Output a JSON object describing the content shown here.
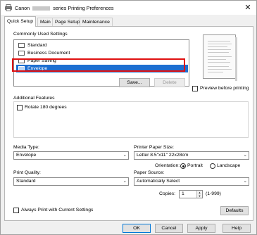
{
  "title": {
    "prefix": "Canon",
    "suffix": "series Printing Preferences",
    "close_glyph": "✕"
  },
  "tabs": [
    {
      "label": "Quick Setup",
      "active": true
    },
    {
      "label": "Main"
    },
    {
      "label": "Page Setup"
    },
    {
      "label": "Maintenance"
    }
  ],
  "commonly_used": {
    "label": "Commonly Used Settings",
    "items": [
      "Standard",
      "Business Document",
      "Paper Saving",
      "Envelope"
    ],
    "selected_index": 3,
    "save_label": "Save...",
    "delete_label": "Delete"
  },
  "preview": {
    "checkbox_label": "Preview before printing",
    "checked": false
  },
  "additional_features": {
    "label": "Additional Features",
    "rotate_label": "Rotate 180 degrees",
    "rotate_checked": false
  },
  "media_type": {
    "label": "Media Type:",
    "value": "Envelope"
  },
  "printer_paper_size": {
    "label": "Printer Paper Size:",
    "value": "Letter 8.5\"x11\" 22x28cm"
  },
  "orientation": {
    "label": "Orientation:",
    "portrait_label": "Portrait",
    "landscape_label": "Landscape",
    "selected": "Portrait"
  },
  "print_quality": {
    "label": "Print Quality:",
    "value": "Standard"
  },
  "paper_source": {
    "label": "Paper Source:",
    "value": "Automatically Select"
  },
  "copies": {
    "label": "Copies:",
    "value": "1",
    "range": "(1-999)"
  },
  "always_print": {
    "label": "Always Print with Current Settings",
    "checked": false
  },
  "defaults_label": "Defaults",
  "dialog_buttons": {
    "ok": "OK",
    "cancel": "Cancel",
    "apply": "Apply",
    "help": "Help"
  },
  "icons": {
    "title": "printer-icon",
    "dropdown": "chevron-down-icon"
  },
  "colors": {
    "selection": "#1d6fd1",
    "highlight": "#e01010"
  }
}
